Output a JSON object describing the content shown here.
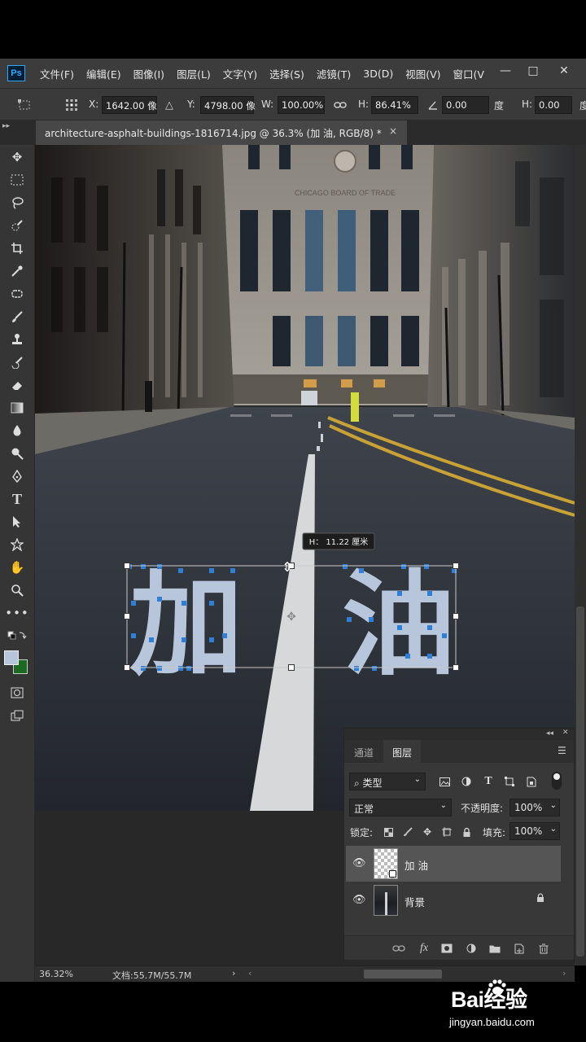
{
  "menubar": {
    "items": [
      "文件(F)",
      "编辑(E)",
      "图像(I)",
      "图层(L)",
      "文字(Y)",
      "选择(S)",
      "滤镜(T)",
      "3D(D)",
      "视图(V)",
      "窗口(V"
    ],
    "app_icon": "Ps"
  },
  "window_controls": {
    "minimize": "—",
    "restore": "□",
    "close": "✕"
  },
  "options": {
    "x_label": "X:",
    "x_value": "1642.00 像",
    "y_label": "Y:",
    "y_value": "4798.00 像",
    "w_label": "W:",
    "w_value": "100.00%",
    "h_label": "H:",
    "h_value": "86.41%",
    "angle_value": "0.00",
    "angle_unit": "度",
    "hskew_label": "H:",
    "hskew_value": "0.00",
    "trailing": "度"
  },
  "document_tab": {
    "title": "architecture-asphalt-buildings-1816714.jpg @ 36.3% (加 油, RGB/8) *",
    "close": "×"
  },
  "canvas": {
    "text_layer_char1": "加",
    "text_layer_char2": "油",
    "building_sign": "CHICAGO BOARD OF TRADE",
    "transform_tooltip": "H： 11.22 厘米"
  },
  "layers_panel": {
    "tabs": [
      "通道",
      "图层"
    ],
    "active_tab": "图层",
    "filter_kind": "类型",
    "blend_mode": "正常",
    "opacity_label": "不透明度:",
    "opacity_value": "100%",
    "lock_label": "锁定:",
    "fill_label": "填充:",
    "fill_value": "100%",
    "layers": [
      {
        "name": "加 油",
        "selected": true,
        "locked": false
      },
      {
        "name": "背景",
        "selected": false,
        "locked": true
      }
    ]
  },
  "status": {
    "zoom": "36.32%",
    "doc_size": "文档:55.7M/55.7M"
  },
  "watermark": {
    "logo": "Bai经验",
    "url": "jingyan.baidu.com"
  },
  "colors": {
    "accent_blue": "#31a8ff",
    "handle_blue": "#2f7fd8",
    "text_layer_fill": "#b8c6dc",
    "ui_dark": "#353535"
  }
}
